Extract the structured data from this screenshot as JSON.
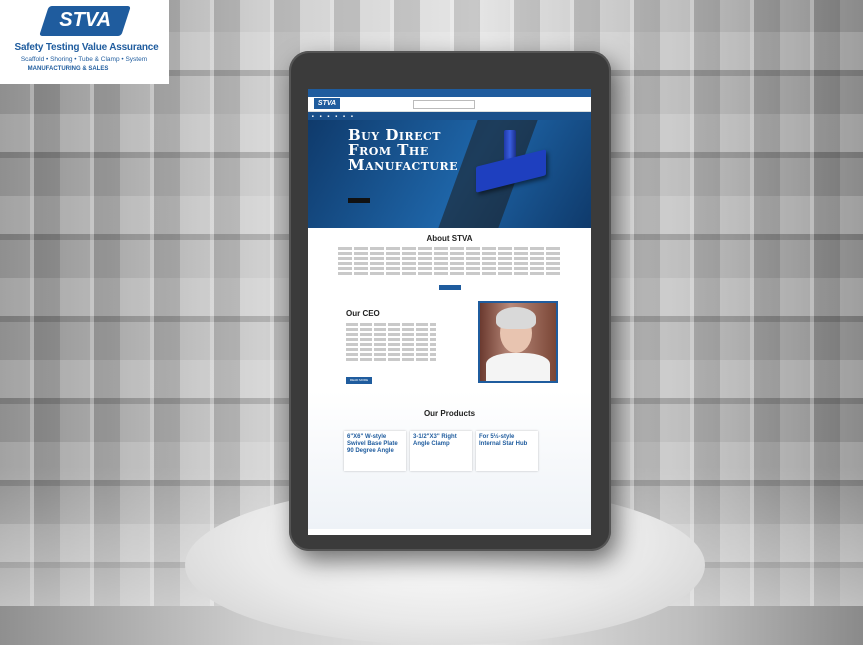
{
  "logo": {
    "badge": "STVA",
    "name": "Safety Testing Value Assurance",
    "tagline": "Scaffold • Shoring • Tube & Clamp • System",
    "sub": "MANUFACTURING & SALES"
  },
  "site": {
    "hero_line1": "Buy Direct",
    "hero_line2": "From The",
    "hero_line3": "Manufacture",
    "about_title": "About STVA",
    "ceo_title": "Our CEO",
    "ceo_button": "READ MORE",
    "products_title": "Our Products",
    "product1": "6\"X6\" W-style Swivel Base Plate 90 Degree Angle",
    "product2": "3-1/2\"X3\" Right Angle Clamp",
    "product3": "For 5½-style Internal Star Hub"
  }
}
